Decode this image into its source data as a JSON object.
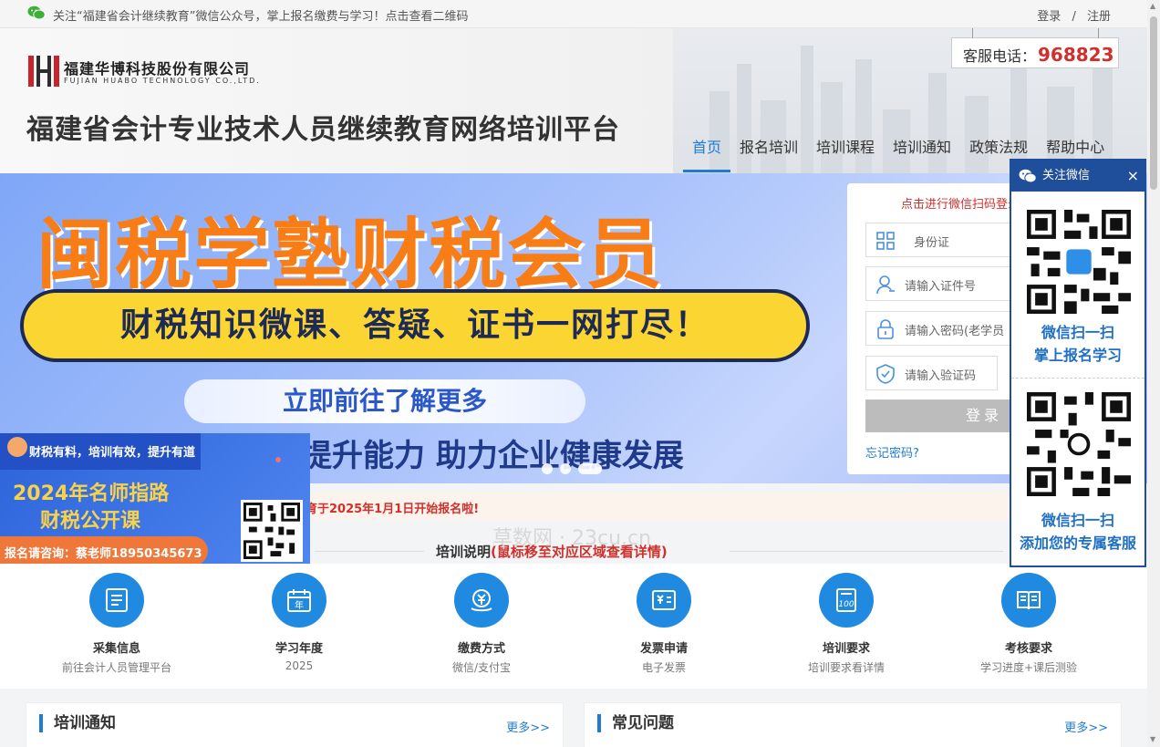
{
  "topbar": {
    "notice": "关注“福建省会计继续教育”微信公众号，掌上报名缴费与学习！点击查看二维码",
    "login": "登录",
    "separator": "/",
    "register": "注册"
  },
  "header": {
    "company_cn": "福建华博科技股份有限公司",
    "company_en": "FUJIAN HUABO TECHNOLOGY CO.,LTD.",
    "site_title": "福建省会计专业技术人员继续教育网络培训平台",
    "hotline_label": "客服电话：",
    "hotline_number": "968823"
  },
  "nav": [
    "首页",
    "报名培训",
    "培训课程",
    "培训通知",
    "政策法规",
    "帮助中心"
  ],
  "banner": {
    "title": "闽税学塾财税会员",
    "pill": "财税知识微课、答疑、证书一网打尽！",
    "button": "立即前往了解更多",
    "subtitle": "提升能力 助力企业健康发展"
  },
  "login": {
    "hint": "点击进行微信扫码登录",
    "id_type": "身份证",
    "id_placeholder": "请输入证件号",
    "password_placeholder": "请输入密码(老学员",
    "captcha_placeholder": "请输入验证码",
    "submit": "登录",
    "forgot": "忘记密码?"
  },
  "ticker": "育于2025年1月1日开始报名啦!",
  "promo": {
    "tag": "财税有料，培训有效，提升有道",
    "line1": "2024年名师指路",
    "line2": "财税公开课",
    "contact": "报名请咨询：蔡老师18950345673"
  },
  "section": {
    "title": "培训说明",
    "note": "(鼠标移至对应区域查看详情)"
  },
  "watermark": "草数网 · 23cu.cn",
  "features": [
    {
      "title": "采集信息",
      "sub": "前往会计人员管理平台",
      "icon": "form-icon"
    },
    {
      "title": "学习年度",
      "sub": "2025",
      "icon": "calendar-icon"
    },
    {
      "title": "缴费方式",
      "sub": "微信/支付宝",
      "icon": "payment-icon"
    },
    {
      "title": "发票申请",
      "sub": "电子发票",
      "icon": "invoice-icon"
    },
    {
      "title": "培训要求",
      "sub": "培训要求看详情",
      "icon": "score-icon"
    },
    {
      "title": "考核要求",
      "sub": "学习进度+课后测验",
      "icon": "book-icon"
    }
  ],
  "panels": {
    "notice": {
      "title": "培训通知",
      "more": "更多>>"
    },
    "faq": {
      "title": "常见问题",
      "more": "更多>>"
    }
  },
  "wechat_panel": {
    "header": "关注微信",
    "close": "×",
    "cap1a": "微信扫一扫",
    "cap1b": "掌上报名学习",
    "cap2a": "微信扫一扫",
    "cap2b": "添加您的专属客服"
  },
  "colors": {
    "accent": "#1f7bd4",
    "red": "#d0302c",
    "banner_orange": "#f97d16",
    "panel_blue": "#1f4f9b"
  }
}
